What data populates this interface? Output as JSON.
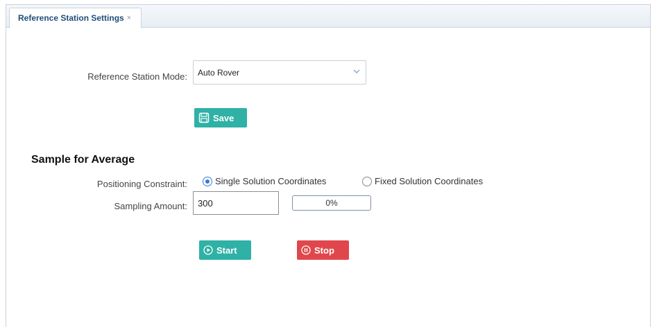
{
  "tab": {
    "title": "Reference Station Settings",
    "close_glyph": "×"
  },
  "mode": {
    "label": "Reference Station Mode:",
    "selected": "Auto Rover"
  },
  "save_button": {
    "label": "Save",
    "icon": "save-icon"
  },
  "sample": {
    "title": "Sample for Average",
    "constraint_label": "Positioning Constraint:",
    "options": [
      {
        "label": "Single Solution Coordinates",
        "checked": true
      },
      {
        "label": "Fixed Solution Coordinates",
        "checked": false
      }
    ],
    "amount_label": "Sampling Amount:",
    "amount_value": "300",
    "progress_text": "0%",
    "progress_fraction": 0
  },
  "start_button": {
    "label": "Start",
    "icon": "play-circle-icon"
  },
  "stop_button": {
    "label": "Stop",
    "icon": "pause-circle-icon"
  },
  "colors": {
    "accent": "#2fb1a6",
    "danger": "#e0474c",
    "tab_text": "#1f4d7a"
  }
}
